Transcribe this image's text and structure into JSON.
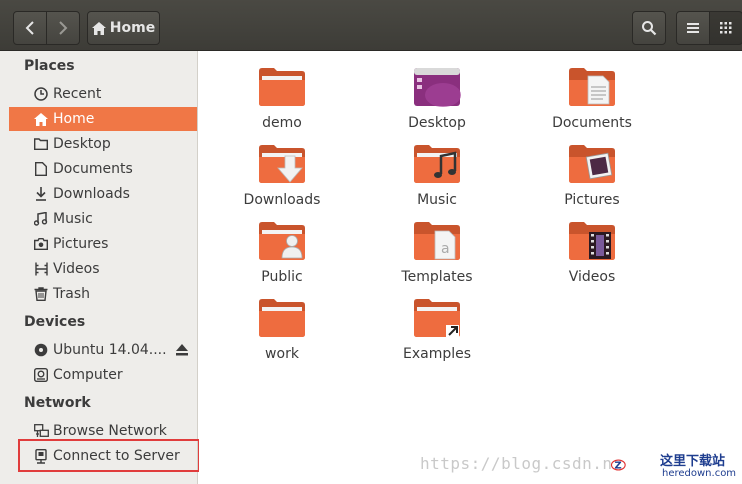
{
  "header": {
    "path_label": "Home",
    "icons": [
      "back-arrow-icon",
      "forward-arrow-icon",
      "home-icon",
      "search-icon",
      "list-view-icon",
      "grid-view-icon"
    ]
  },
  "sidebar": {
    "places_title": "Places",
    "places": [
      {
        "label": "Recent",
        "icon": "clock-icon"
      },
      {
        "label": "Home",
        "icon": "home-icon",
        "active": true
      },
      {
        "label": "Desktop",
        "icon": "folder-icon"
      },
      {
        "label": "Documents",
        "icon": "document-icon"
      },
      {
        "label": "Downloads",
        "icon": "download-icon"
      },
      {
        "label": "Music",
        "icon": "music-icon"
      },
      {
        "label": "Pictures",
        "icon": "camera-icon"
      },
      {
        "label": "Videos",
        "icon": "film-icon"
      },
      {
        "label": "Trash",
        "icon": "trash-icon"
      }
    ],
    "devices_title": "Devices",
    "devices": [
      {
        "label": "Ubuntu 14.04....",
        "icon": "disc-icon"
      },
      {
        "label": "Computer",
        "icon": "drive-icon"
      }
    ],
    "network_title": "Network",
    "network": [
      {
        "label": "Browse Network",
        "icon": "network-icon"
      },
      {
        "label": "Connect to Server",
        "icon": "server-icon"
      }
    ]
  },
  "files": [
    {
      "label": "demo",
      "kind": "plain"
    },
    {
      "label": "Desktop",
      "kind": "desktop"
    },
    {
      "label": "Documents",
      "kind": "documents"
    },
    {
      "label": "Downloads",
      "kind": "downloads"
    },
    {
      "label": "Music",
      "kind": "music"
    },
    {
      "label": "Pictures",
      "kind": "pictures"
    },
    {
      "label": "Public",
      "kind": "public"
    },
    {
      "label": "Templates",
      "kind": "templates"
    },
    {
      "label": "Videos",
      "kind": "videos"
    },
    {
      "label": "work",
      "kind": "plain"
    },
    {
      "label": "Examples",
      "kind": "link"
    }
  ],
  "colors": {
    "accent": "#f07746",
    "folder_orange": "#e8643a",
    "header_dark": "#3d3c37",
    "sidebar_bg": "#eeedea",
    "highlight_red": "#e03c3c"
  },
  "watermark": {
    "url_text": "https://blog.csdn.n",
    "logo_title": "这里下载站",
    "logo_sub": "heredown.com"
  }
}
